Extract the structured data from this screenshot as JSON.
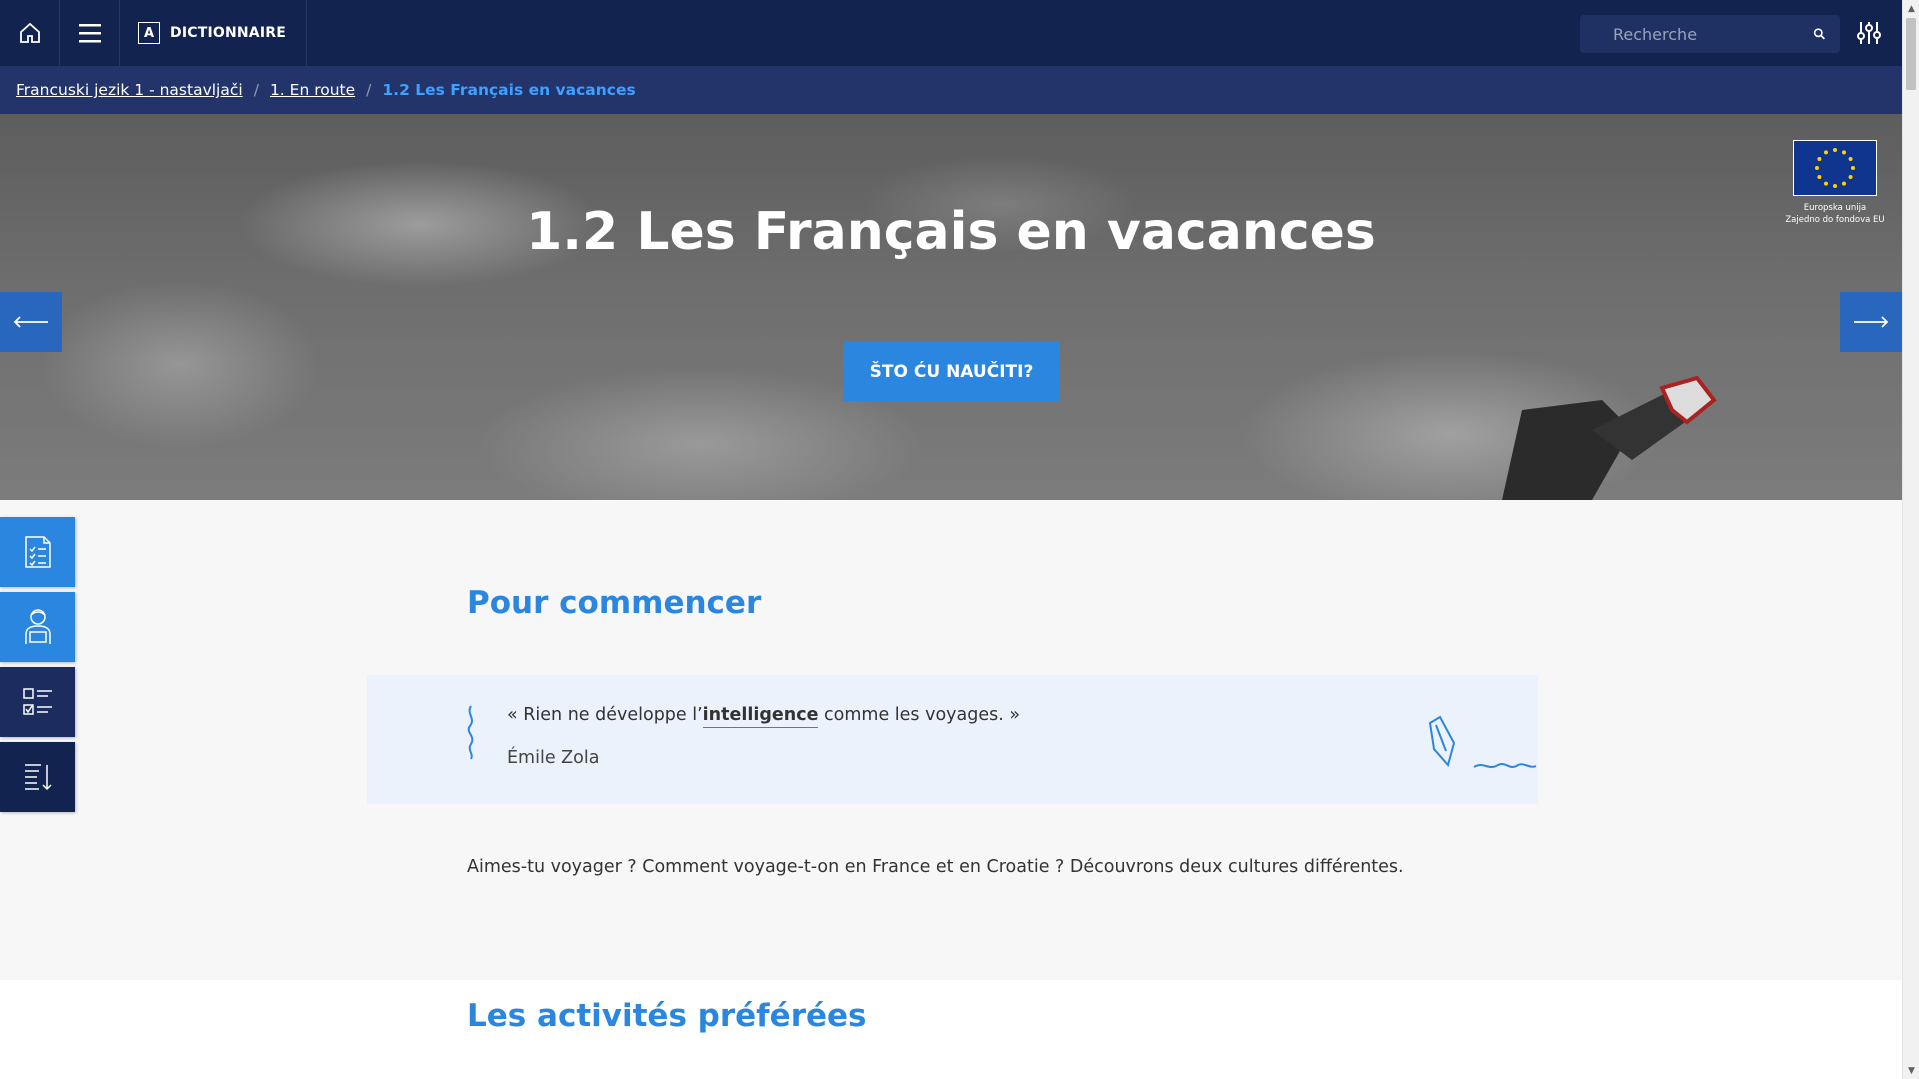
{
  "topbar": {
    "dictionary_letter": "A",
    "dictionary_label": "DICTIONNAIRE",
    "search_placeholder": "Recherche"
  },
  "breadcrumb": {
    "items": [
      "Francuski jezik 1 - nastavljači",
      "1. En route"
    ],
    "current": "1.2 Les Français en vacances",
    "separator": "/"
  },
  "hero": {
    "title": "1.2 Les Français en vacances",
    "cta_label": "ŠTO ĆU NAUČITI?",
    "eu_line1": "Europska unija",
    "eu_line2": "Zajedno do fondova EU"
  },
  "content": {
    "section1_title": "Pour commencer",
    "quote_before": "« Rien ne développe l’",
    "quote_keyword": "intelligence",
    "quote_after": " comme les voyages. »",
    "quote_author": "Émile Zola",
    "intro": "Aimes-tu voyager ? Comment voyage-t-on en France et en Croatie ? Découvrons deux cultures différentes.",
    "section2_title": "Les activités préférées"
  },
  "colors": {
    "navy": "#13234f",
    "breadcrumb_bg": "#23346a",
    "accent": "#2a86de",
    "quote_bg": "#ecf2fb"
  }
}
